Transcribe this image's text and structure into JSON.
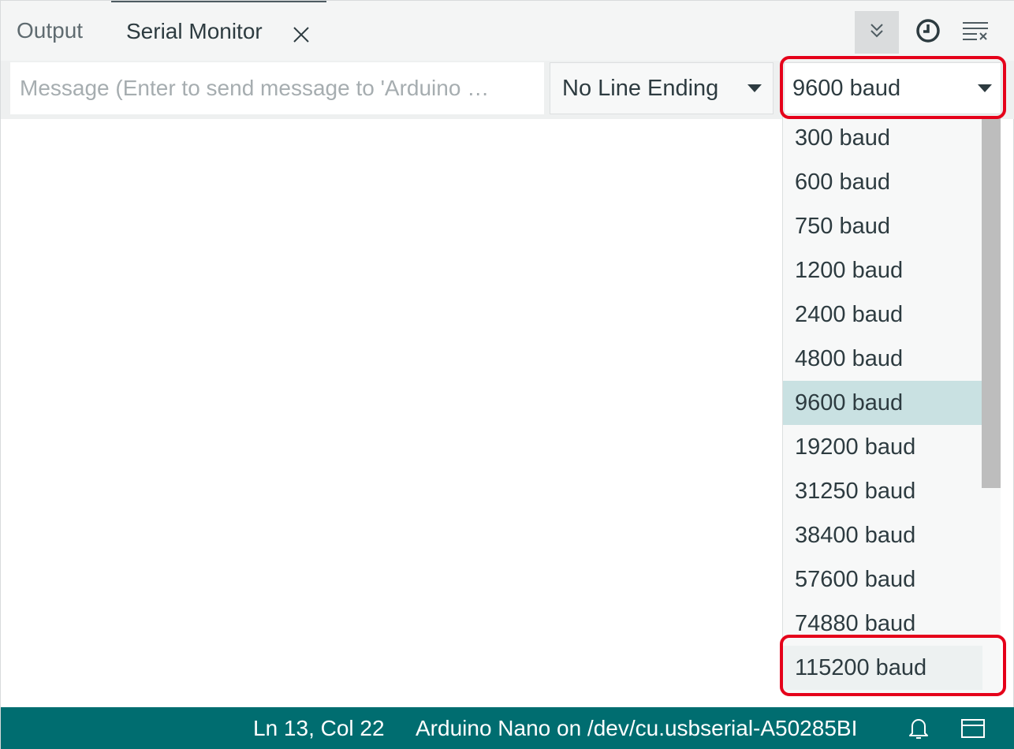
{
  "tabs": {
    "output_label": "Output",
    "serial_label": "Serial Monitor"
  },
  "toolbar_icons": [
    "toggle-autoscroll-icon",
    "clock-icon",
    "clear-output-icon"
  ],
  "message": {
    "value": "",
    "placeholder": "Message (Enter to send message to 'Arduino …"
  },
  "line_ending": {
    "selected": "No Line Ending"
  },
  "baud": {
    "selected": "9600 baud",
    "options": [
      "300 baud",
      "600 baud",
      "750 baud",
      "1200 baud",
      "2400 baud",
      "4800 baud",
      "9600 baud",
      "19200 baud",
      "31250 baud",
      "38400 baud",
      "57600 baud",
      "74880 baud",
      "115200 baud"
    ]
  },
  "status": {
    "position": "Ln 13, Col 22",
    "board": "Arduino Nano on /dev/cu.usbserial-A50285BI"
  },
  "colors": {
    "statusbar": "#006d70",
    "selected_option": "#c9e1e2",
    "annotation": "#e5001a"
  }
}
